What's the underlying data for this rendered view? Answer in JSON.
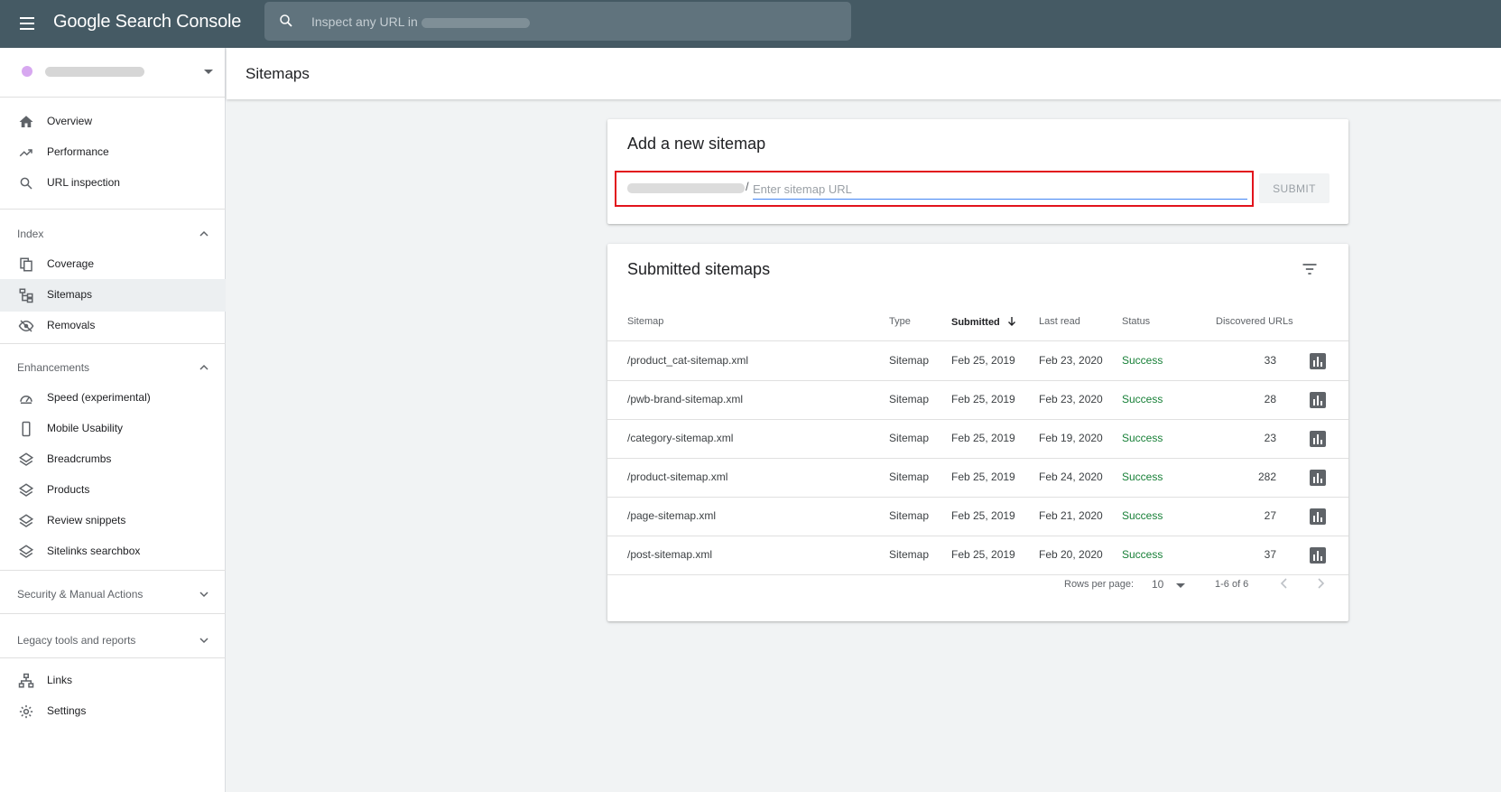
{
  "app": {
    "brand": "Google Search Console",
    "search_placeholder": "Inspect any URL in"
  },
  "sidebar": {
    "items_top": [
      {
        "label": "Overview",
        "icon": "home-icon"
      },
      {
        "label": "Performance",
        "icon": "trending-up-icon"
      },
      {
        "label": "URL inspection",
        "icon": "search-icon"
      }
    ],
    "index": {
      "label": "Index",
      "items": [
        {
          "label": "Coverage",
          "icon": "copy-icon"
        },
        {
          "label": "Sitemaps",
          "icon": "sitemap-icon",
          "active": true
        },
        {
          "label": "Removals",
          "icon": "eye-off-icon"
        }
      ]
    },
    "enhancements": {
      "label": "Enhancements",
      "items": [
        {
          "label": "Speed (experimental)",
          "icon": "speedometer-icon"
        },
        {
          "label": "Mobile Usability",
          "icon": "phone-icon"
        },
        {
          "label": "Breadcrumbs",
          "icon": "layers-icon"
        },
        {
          "label": "Products",
          "icon": "layers-icon"
        },
        {
          "label": "Review snippets",
          "icon": "layers-icon"
        },
        {
          "label": "Sitelinks searchbox",
          "icon": "layers-icon"
        }
      ]
    },
    "security": {
      "label": "Security & Manual Actions"
    },
    "legacy": {
      "label": "Legacy tools and reports"
    },
    "items_bottom": [
      {
        "label": "Links",
        "icon": "links-icon"
      },
      {
        "label": "Settings",
        "icon": "gear-icon"
      }
    ]
  },
  "page": {
    "title": "Sitemaps"
  },
  "add_sitemap": {
    "title": "Add a new sitemap",
    "slash": "/",
    "placeholder": "Enter sitemap URL",
    "submit_label": "SUBMIT"
  },
  "submitted": {
    "title": "Submitted sitemaps",
    "columns": {
      "sitemap": "Sitemap",
      "type": "Type",
      "submitted": "Submitted",
      "last_read": "Last read",
      "status": "Status",
      "discovered": "Discovered URLs"
    },
    "rows": [
      {
        "sitemap": "/product_cat-sitemap.xml",
        "type": "Sitemap",
        "submitted": "Feb 25, 2019",
        "last_read": "Feb 23, 2020",
        "status": "Success",
        "discovered": "33"
      },
      {
        "sitemap": "/pwb-brand-sitemap.xml",
        "type": "Sitemap",
        "submitted": "Feb 25, 2019",
        "last_read": "Feb 23, 2020",
        "status": "Success",
        "discovered": "28"
      },
      {
        "sitemap": "/category-sitemap.xml",
        "type": "Sitemap",
        "submitted": "Feb 25, 2019",
        "last_read": "Feb 19, 2020",
        "status": "Success",
        "discovered": "23"
      },
      {
        "sitemap": "/product-sitemap.xml",
        "type": "Sitemap",
        "submitted": "Feb 25, 2019",
        "last_read": "Feb 24, 2020",
        "status": "Success",
        "discovered": "282"
      },
      {
        "sitemap": "/page-sitemap.xml",
        "type": "Sitemap",
        "submitted": "Feb 25, 2019",
        "last_read": "Feb 21, 2020",
        "status": "Success",
        "discovered": "27"
      },
      {
        "sitemap": "/post-sitemap.xml",
        "type": "Sitemap",
        "submitted": "Feb 25, 2019",
        "last_read": "Feb 20, 2020",
        "status": "Success",
        "discovered": "37"
      }
    ],
    "pager": {
      "rows_per_page_label": "Rows per page:",
      "rows_per_page": "10",
      "range": "1-6 of 6"
    }
  },
  "colors": {
    "topbar": "#455a64",
    "success": "#188038",
    "highlight": "#e2141c"
  }
}
